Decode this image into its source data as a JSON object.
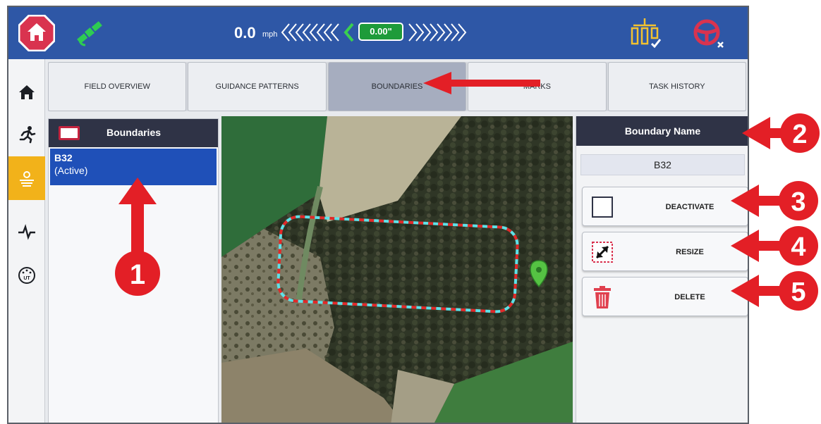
{
  "topbar": {
    "speed_value": "0.0",
    "speed_unit": "mph",
    "offset": "0.00\"",
    "colors": {
      "bar": "#2e57a6",
      "home": "#d9334f",
      "offset_box": "#1e9b3a"
    },
    "icons": [
      "home-icon",
      "gps-satellite-icon",
      "left-chevrons-icon",
      "right-chevrons-icon",
      "implement-icon",
      "steering-wheel-icon"
    ]
  },
  "rail": {
    "items": [
      {
        "name": "home",
        "icon": "home-icon"
      },
      {
        "name": "operator",
        "icon": "running-person-icon"
      },
      {
        "name": "field",
        "icon": "field-icon",
        "active": true
      },
      {
        "name": "diagnostics",
        "icon": "pulse-icon"
      },
      {
        "name": "ut",
        "icon": "ut-icon",
        "label": "UT"
      }
    ]
  },
  "tabs": [
    {
      "label": "FIELD OVERVIEW"
    },
    {
      "label": "GUIDANCE PATTERNS"
    },
    {
      "label": "BOUNDARIES",
      "active": true
    },
    {
      "label": "MARKS"
    },
    {
      "label": "TASK HISTORY"
    }
  ],
  "boundaries_panel": {
    "title": "Boundaries",
    "items": [
      {
        "name": "B32",
        "status": "(Active)"
      }
    ]
  },
  "details_panel": {
    "title": "Boundary Name",
    "name_value": "B32",
    "buttons": [
      {
        "label": "DEACTIVATE",
        "icon": "checkbox-empty-icon"
      },
      {
        "label": "RESIZE",
        "icon": "resize-arrow-icon"
      },
      {
        "label": "DELETE",
        "icon": "trash-icon"
      }
    ]
  },
  "callouts": [
    "1",
    "2",
    "3",
    "4",
    "5"
  ]
}
